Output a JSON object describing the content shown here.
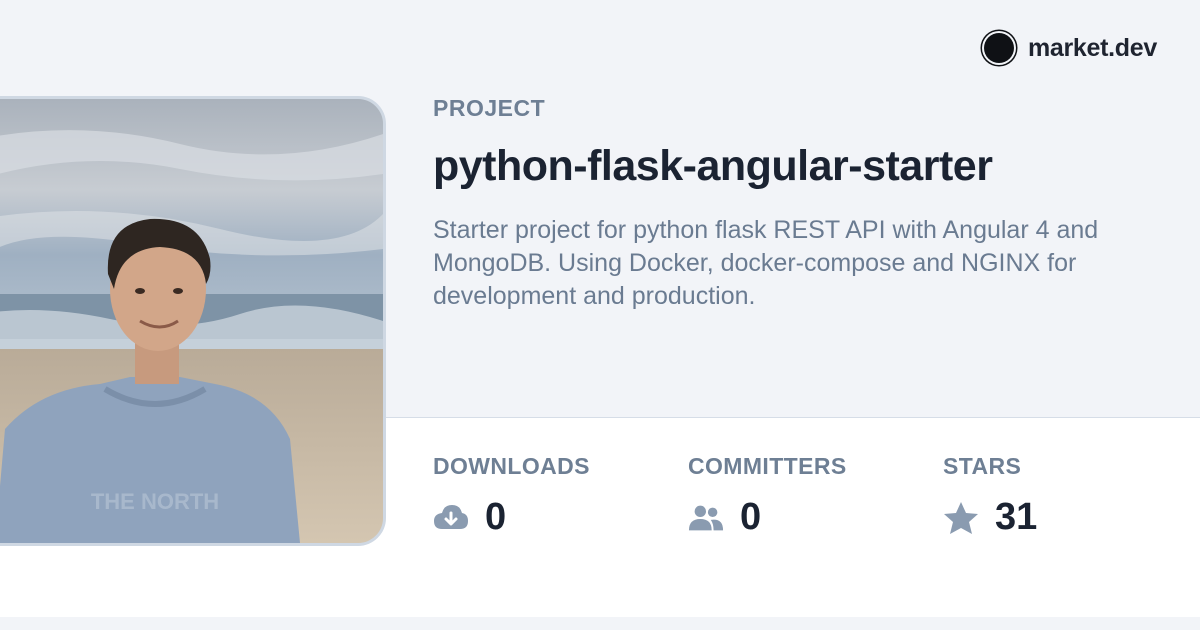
{
  "brand": {
    "name": "market.dev",
    "logo_icon": "circle-logo-icon"
  },
  "project": {
    "label": "PROJECT",
    "title": "python-flask-angular-starter",
    "description": "Starter project for python flask REST API with Angular 4 and MongoDB. Using Docker, docker-compose and NGINX for development and production."
  },
  "stats": {
    "downloads": {
      "label": "DOWNLOADS",
      "value": "0",
      "icon": "cloud-download-icon"
    },
    "committers": {
      "label": "COMMITTERS",
      "value": "0",
      "icon": "users-icon"
    },
    "stars": {
      "label": "STARS",
      "value": "31",
      "icon": "star-icon"
    }
  },
  "colors": {
    "accent_text": "#1b2332",
    "muted_text": "#6e7f94",
    "background": "#f2f4f8"
  }
}
